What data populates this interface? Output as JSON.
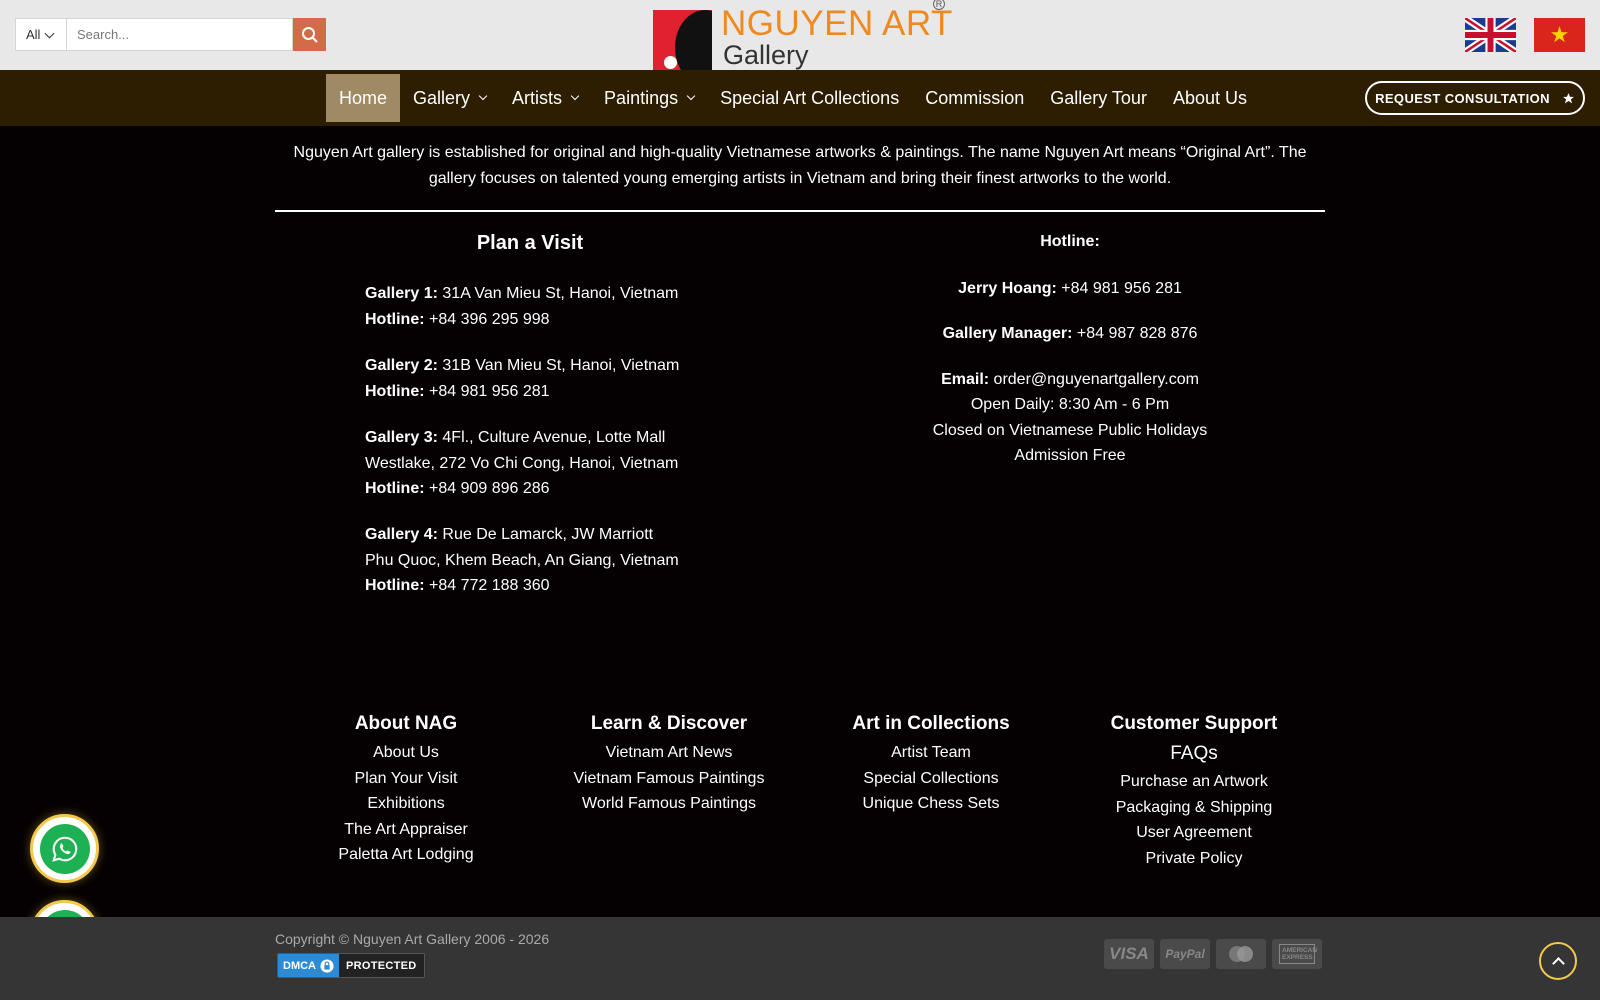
{
  "header": {
    "search_category": "All",
    "search_placeholder": "Search...",
    "logo_name": "NGUYEN ART",
    "logo_sub": "Gallery",
    "logo_registered": "R"
  },
  "nav": {
    "items": [
      {
        "label": "Home",
        "active": true
      },
      {
        "label": "Gallery",
        "dropdown": true
      },
      {
        "label": "Artists",
        "dropdown": true
      },
      {
        "label": "Paintings",
        "dropdown": true
      },
      {
        "label": "Special Art Collections"
      },
      {
        "label": "Commission"
      },
      {
        "label": "Gallery Tour"
      },
      {
        "label": "About Us"
      }
    ],
    "cta_label": "REQUEST CONSULTATION"
  },
  "intro": "Nguyen Art gallery is established for original and high-quality Vietnamese artworks & paintings. The name Nguyen Art means “Original Art”. The gallery focuses on talented young emerging artists in Vietnam and bring their finest artworks to the world.",
  "visit": {
    "title": "Plan a Visit",
    "galleries": [
      {
        "name": "Gallery 1:",
        "address": "31A Van Mieu St, Hanoi, Vietnam",
        "hotline_label": "Hotline:",
        "hotline": "+84 396 295 998"
      },
      {
        "name": "Gallery 2:",
        "address": "31B Van Mieu St, Hanoi, Vietnam",
        "hotline_label": "Hotline:",
        "hotline": "+84 981 956 281"
      },
      {
        "name": "Gallery 3:",
        "address": "4Fl., Culture Avenue, Lotte Mall Westlake, 272 Vo Chi Cong, Hanoi, Vietnam",
        "hotline_label": "Hotline:",
        "hotline": "+84 909 896 286"
      },
      {
        "name": "Gallery 4:",
        "address": "Rue De Lamarck, JW Marriott Phu Quoc, Khem Beach, An Giang, Vietnam",
        "hotline_label": "Hotline:",
        "hotline": "+84 772 188 360"
      }
    ]
  },
  "contact": {
    "title": "Hotline:",
    "jerry_label": "Jerry Hoang:",
    "jerry_phone": "+84 981 956 281",
    "manager_label": "Gallery Manager:",
    "manager_phone": "+84 987 828 876",
    "email_label": "Email:",
    "email": "order@nguyenartgallery.com",
    "hours": "Open Daily: 8:30 Am - 6 Pm",
    "closed": "Closed on Vietnamese Public Holidays",
    "admission": "Admission Free"
  },
  "footer_columns": {
    "about": {
      "title": "About NAG",
      "links": [
        "About Us",
        "Plan Your Visit",
        "Exhibitions",
        "The Art Appraiser",
        "Paletta Art Lodging"
      ]
    },
    "learn": {
      "title": "Learn & Discover",
      "links": [
        "Vietnam Art News",
        "Vietnam Famous Paintings",
        "World Famous Paintings"
      ]
    },
    "collections": {
      "title": "Art in Collections",
      "links": [
        "Artist Team",
        "Special Collections",
        "Unique Chess Sets"
      ]
    },
    "support": {
      "title": "Customer Support",
      "faq": "FAQs",
      "links": [
        "Purchase an Artwork",
        "Packaging & Shipping",
        "User Agreement",
        "Private Policy"
      ]
    }
  },
  "bottom": {
    "copyright": "Copyright © Nguyen Art Gallery 2006 - 2026",
    "dmca_left": "DMCA",
    "dmca_right": "PROTECTED",
    "payments": [
      "VISA",
      "PayPal",
      "",
      "AMERICAN EXPRESS"
    ]
  },
  "colors": {
    "topbar": "#e8e8e8",
    "navbar": "#2d1e02",
    "active_nav": "#a08a64",
    "search_button": "#d26b48",
    "logo_orange": "#f08a1e",
    "whatsapp_green": "#1eb154",
    "float_ring": "#f2c94c"
  }
}
